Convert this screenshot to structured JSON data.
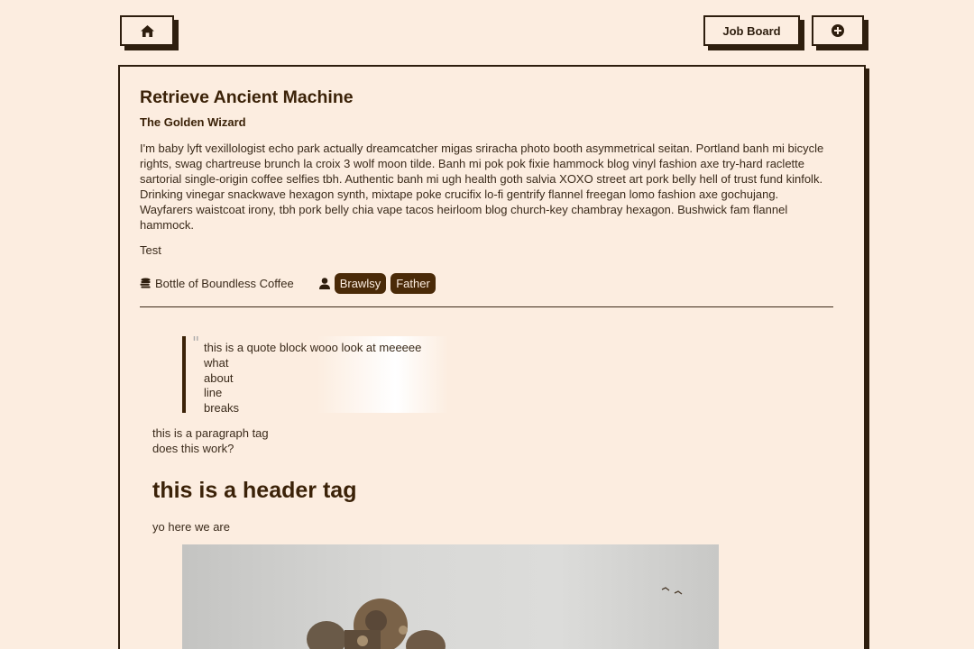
{
  "nav": {
    "home_icon": "home-icon",
    "job_board_label": "Job Board",
    "add_icon": "plus-circle-icon"
  },
  "job": {
    "title": "Retrieve Ancient Machine",
    "poster": "The Golden Wizard",
    "description": "I'm baby lyft vexillologist echo park actually dreamcatcher migas sriracha photo booth asymmetrical seitan. Portland banh mi bicycle rights, swag chartreuse brunch la croix 3 wolf moon tilde. Banh mi pok pok fixie hammock blog vinyl fashion axe try-hard raclette sartorial single-origin coffee selfies tbh. Authentic banh mi ugh health goth salvia XOXO street art pork belly hell of trust fund kinfolk. Drinking vinegar snackwave hexagon synth, mixtape poke crucifix lo-fi gentrify flannel freegan lomo fashion axe gochujang. Wayfarers waistcoat irony, tbh pork belly chia vape tacos heirloom blog church-key chambray hexagon. Bushwick fam flannel hammock.",
    "note": "Test",
    "reward": "Bottle of Boundless Coffee",
    "reward_icon": "coins-icon",
    "people_icon": "user-icon",
    "tags": [
      "Brawlsy",
      "Father"
    ]
  },
  "content": {
    "quote_lines": [
      "this is a quote block wooo look at meeeee",
      "what",
      "about",
      "line",
      "breaks"
    ],
    "paragraph_lines": [
      "this is a paragraph tag",
      "does this work?"
    ],
    "header": "this is a header tag",
    "yo": "yo here we are"
  },
  "colors": {
    "background": "#fcede0",
    "dark_brown": "#2e1e0e",
    "tag_bg": "#4a2a08"
  }
}
